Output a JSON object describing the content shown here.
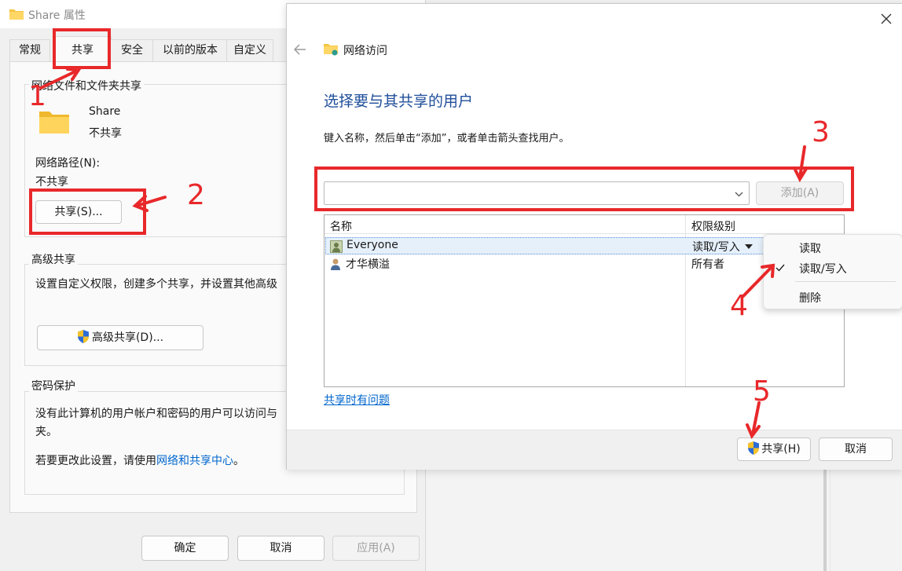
{
  "props_dialog": {
    "title": "Share 属性",
    "tabs": [
      {
        "label": "常规",
        "active": false
      },
      {
        "label": "共享",
        "active": true
      },
      {
        "label": "安全",
        "active": false
      },
      {
        "label": "以前的版本",
        "active": false
      },
      {
        "label": "自定义",
        "active": false
      }
    ],
    "network_sharing": {
      "group_label": "网络文件和文件夹共享",
      "folder_name": "Share",
      "folder_status": "不共享",
      "path_label": "网络路径(N):",
      "path_value": "不共享",
      "share_button": "共享(S)..."
    },
    "advanced_sharing": {
      "group_label": "高级共享",
      "description": "设置自定义权限，创建多个共享，并设置其他高级",
      "button": "高级共享(D)..."
    },
    "password_protection": {
      "group_label": "密码保护",
      "line1": "没有此计算机的用户帐户和密码的用户可以访问与",
      "line2": "夹。",
      "line3_prefix": "若要更改此设置，请使用",
      "line3_link": "网络和共享中心",
      "line3_suffix": "。"
    },
    "buttons": {
      "ok": "确定",
      "cancel": "取消",
      "apply": "应用(A)"
    }
  },
  "share_dialog": {
    "header_title": "网络访问",
    "heading": "选择要与其共享的用户",
    "instruction": "键入名称，然后单击“添加”，或者单击箭头查找用户。",
    "name_input_value": "",
    "add_button": "添加(A)",
    "columns": [
      "名称",
      "权限级别"
    ],
    "rows": [
      {
        "name": "Everyone",
        "permission": "读取/写入",
        "selected": true
      },
      {
        "name": "才华横溢",
        "permission": "所有者",
        "selected": false
      }
    ],
    "trouble_link": "共享时有问题",
    "share_button": "共享(H)",
    "cancel_button": "取消"
  },
  "permission_menu": {
    "items": [
      "读取",
      "读取/写入",
      "删除"
    ],
    "checked": "读取/写入"
  },
  "annotations": [
    "1",
    "2",
    "3",
    "4",
    "5"
  ],
  "colors": {
    "annotation_red": "#e8282a",
    "heading_blue": "#1f4e9a",
    "link_blue": "#0066cc"
  }
}
